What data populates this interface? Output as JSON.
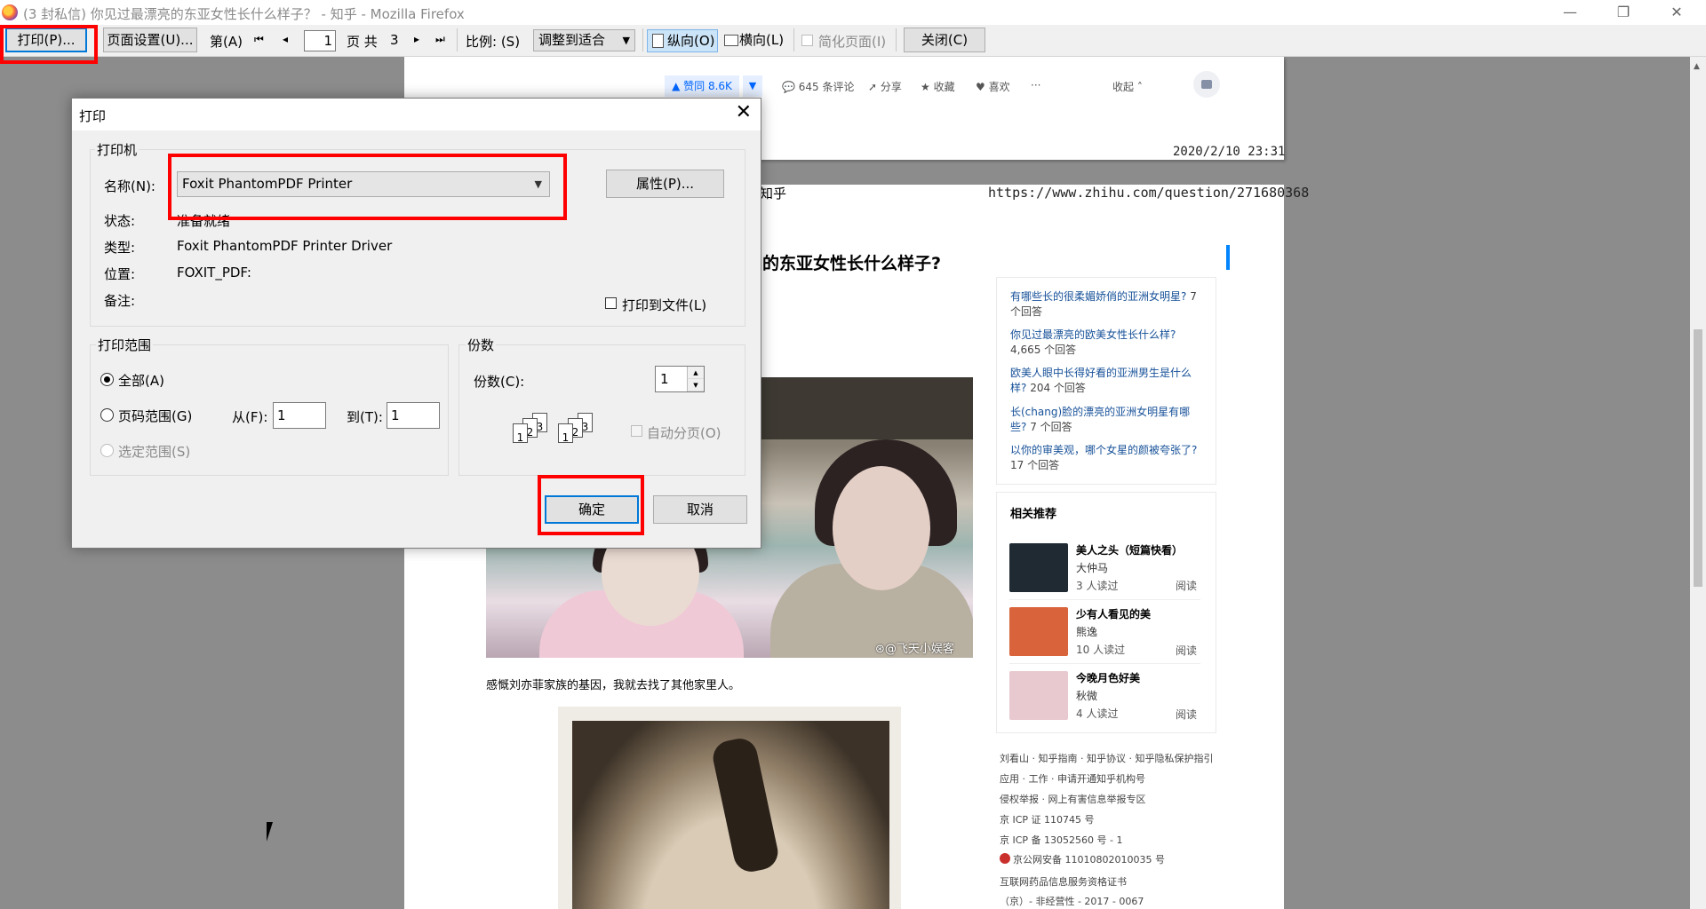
{
  "window": {
    "title": "(3 封私信) 你见过最漂亮的东亚女性长什么样子？ - 知乎 - Mozilla Firefox",
    "minimize": "—",
    "maximize": "❐",
    "close": "✕"
  },
  "toolbar": {
    "print_label": "打印(P)...",
    "page_setup_label": "页面设置(U)...",
    "page_prefix": "第(A)",
    "first_glyph": "⏮",
    "prev_glyph": "◂",
    "page_value": "1",
    "page_suffix": "页 共",
    "total_pages": "3",
    "next_glyph": "▸",
    "last_glyph": "⏭",
    "scale_label": "比例: (S)",
    "scale_value": "调整到适合",
    "portrait_label": "纵向(O)",
    "landscape_label": "横向(L)",
    "simplify_label": "简化页面(I)",
    "close_label": "关闭(C)"
  },
  "page1": {
    "vote": "▲ 赞同 8.6K",
    "vote_down": "▼",
    "comments": "💬 645 条评论",
    "share": "分享",
    "favorite": "★ 收藏",
    "like": "♥ 喜欢",
    "more": "···",
    "collapse": "收起 ˄",
    "datetime": "2020/2/10  23:31"
  },
  "page2": {
    "header_left": "知乎",
    "header_url": "https://www.zhihu.com/question/271680368",
    "question_title": "的东亚女性长什么样子?",
    "related_questions": [
      {
        "text": "有哪些长的很柔媚娇俏的亚洲女明星?",
        "count": "7 个回答"
      },
      {
        "text": "你见过最漂亮的欧美女性长什么样?",
        "count": "4,665 个回答"
      },
      {
        "text": "欧美人眼中长得好看的亚洲男生是什么样?",
        "count": "204 个回答"
      },
      {
        "text": "长(chang)脸的漂亮的亚洲女明星有哪些?",
        "count": "7 个回答"
      },
      {
        "text": "以你的审美观，哪个女星的颜被夸张了?",
        "count": "17 个回答"
      }
    ],
    "recommend_title": "相关推荐",
    "books": [
      {
        "name": "美人之头（短篇快看）",
        "author": "大仲马",
        "reads": "3 人读过",
        "action": "阅读",
        "cover_color": "#1f2a33"
      },
      {
        "name": "少有人看见的美",
        "author": "熊逸",
        "reads": "10 人读过",
        "action": "阅读",
        "cover_color": "#d9633a"
      },
      {
        "name": "今晚月色好美",
        "author": "秋微",
        "reads": "4 人读过",
        "action": "阅读",
        "cover_color": "#e8c9cf"
      }
    ],
    "footer": [
      "刘看山 · 知乎指南 · 知乎协议 · 知乎隐私保护指引",
      "应用 · 工作 · 申请开通知乎机构号",
      "侵权举报 · 网上有害信息举报专区",
      "京 ICP 证 110745 号",
      "京 ICP 备 13052560 号 - 1",
      "京公网安备 11010802010035 号",
      "互联网药品信息服务资格证书",
      "（京）- 非经营性 - 2017 - 0067"
    ],
    "watermark": "@飞天小娱客",
    "caption": "感慨刘亦菲家族的基因，我就去找了其他家里人。"
  },
  "dialog": {
    "title": "打印",
    "close": "✕",
    "printer_group": "打印机",
    "name_label": "名称(N):",
    "printer_name": "Foxit PhantomPDF Printer",
    "properties_label": "属性(P)...",
    "status_label": "状态:",
    "status_value": "准备就绪",
    "type_label": "类型:",
    "type_value": "Foxit PhantomPDF Printer Driver",
    "location_label": "位置:",
    "location_value": "FOXIT_PDF:",
    "comment_label": "备注:",
    "print_to_file_label": "打印到文件(L)",
    "range_group": "打印范围",
    "all_label": "全部(A)",
    "pages_label": "页码范围(G)",
    "from_label": "从(F):",
    "from_value": "1",
    "to_label": "到(T):",
    "to_value": "1",
    "selection_label": "选定范围(S)",
    "copies_group": "份数",
    "copies_label": "份数(C):",
    "copies_value": "1",
    "collate_label": "自动分页(O)",
    "ok_label": "确定",
    "cancel_label": "取消"
  },
  "highlight_color": "#ff0000"
}
